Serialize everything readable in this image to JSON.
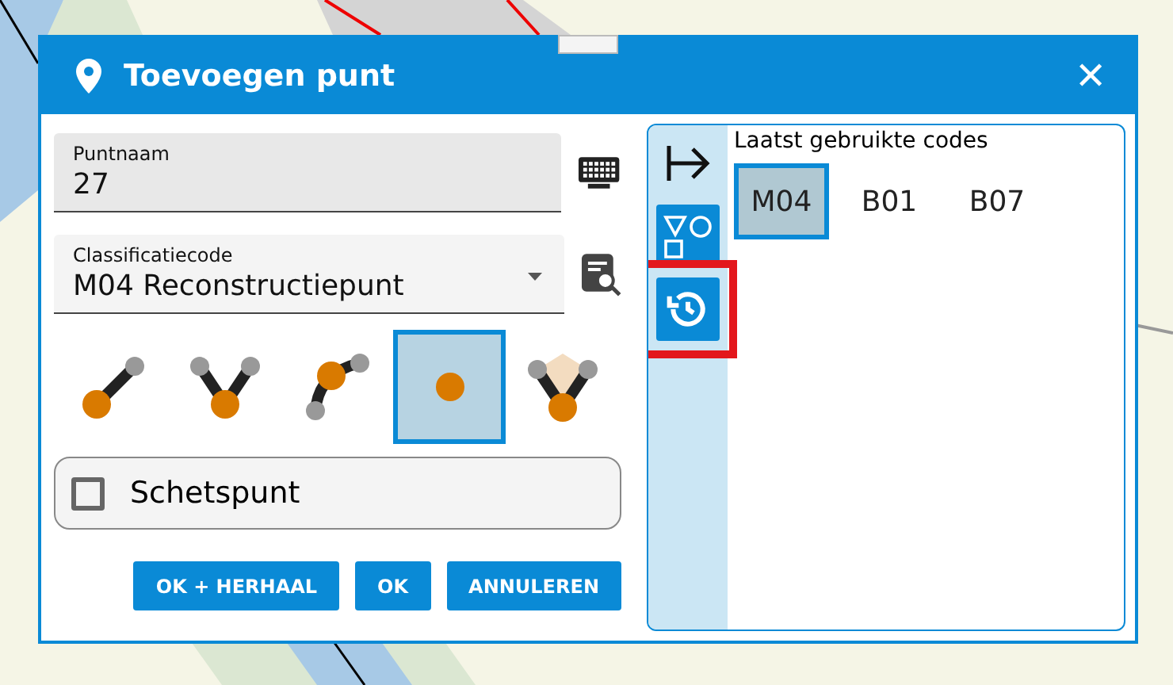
{
  "window": {
    "title": "Toevoegen punt",
    "close": "✕"
  },
  "point_name": {
    "label": "Puntnaam",
    "value": "27"
  },
  "classification": {
    "label": "Classificatiecode",
    "value": "M04 Reconstructiepunt"
  },
  "point_types": [
    {
      "kind": "line",
      "selected": false
    },
    {
      "kind": "vee",
      "selected": false
    },
    {
      "kind": "arc",
      "selected": false
    },
    {
      "kind": "dot",
      "selected": true
    },
    {
      "kind": "angle",
      "selected": false
    }
  ],
  "sketch_point": {
    "label": "Schetspunt",
    "checked": false
  },
  "buttons": [
    "OK + HERHAAL",
    "OK",
    "ANNULEREN"
  ],
  "side_tabs": [
    {
      "kind": "arrow",
      "filled": false
    },
    {
      "kind": "shapes",
      "filled": true
    },
    {
      "kind": "history",
      "filled": true,
      "highlighted": true
    }
  ],
  "recent": {
    "title": "Laatst gebruikte codes",
    "codes": [
      {
        "label": "M04",
        "selected": true
      },
      {
        "label": "B01",
        "selected": false
      },
      {
        "label": "B07",
        "selected": false
      }
    ]
  }
}
